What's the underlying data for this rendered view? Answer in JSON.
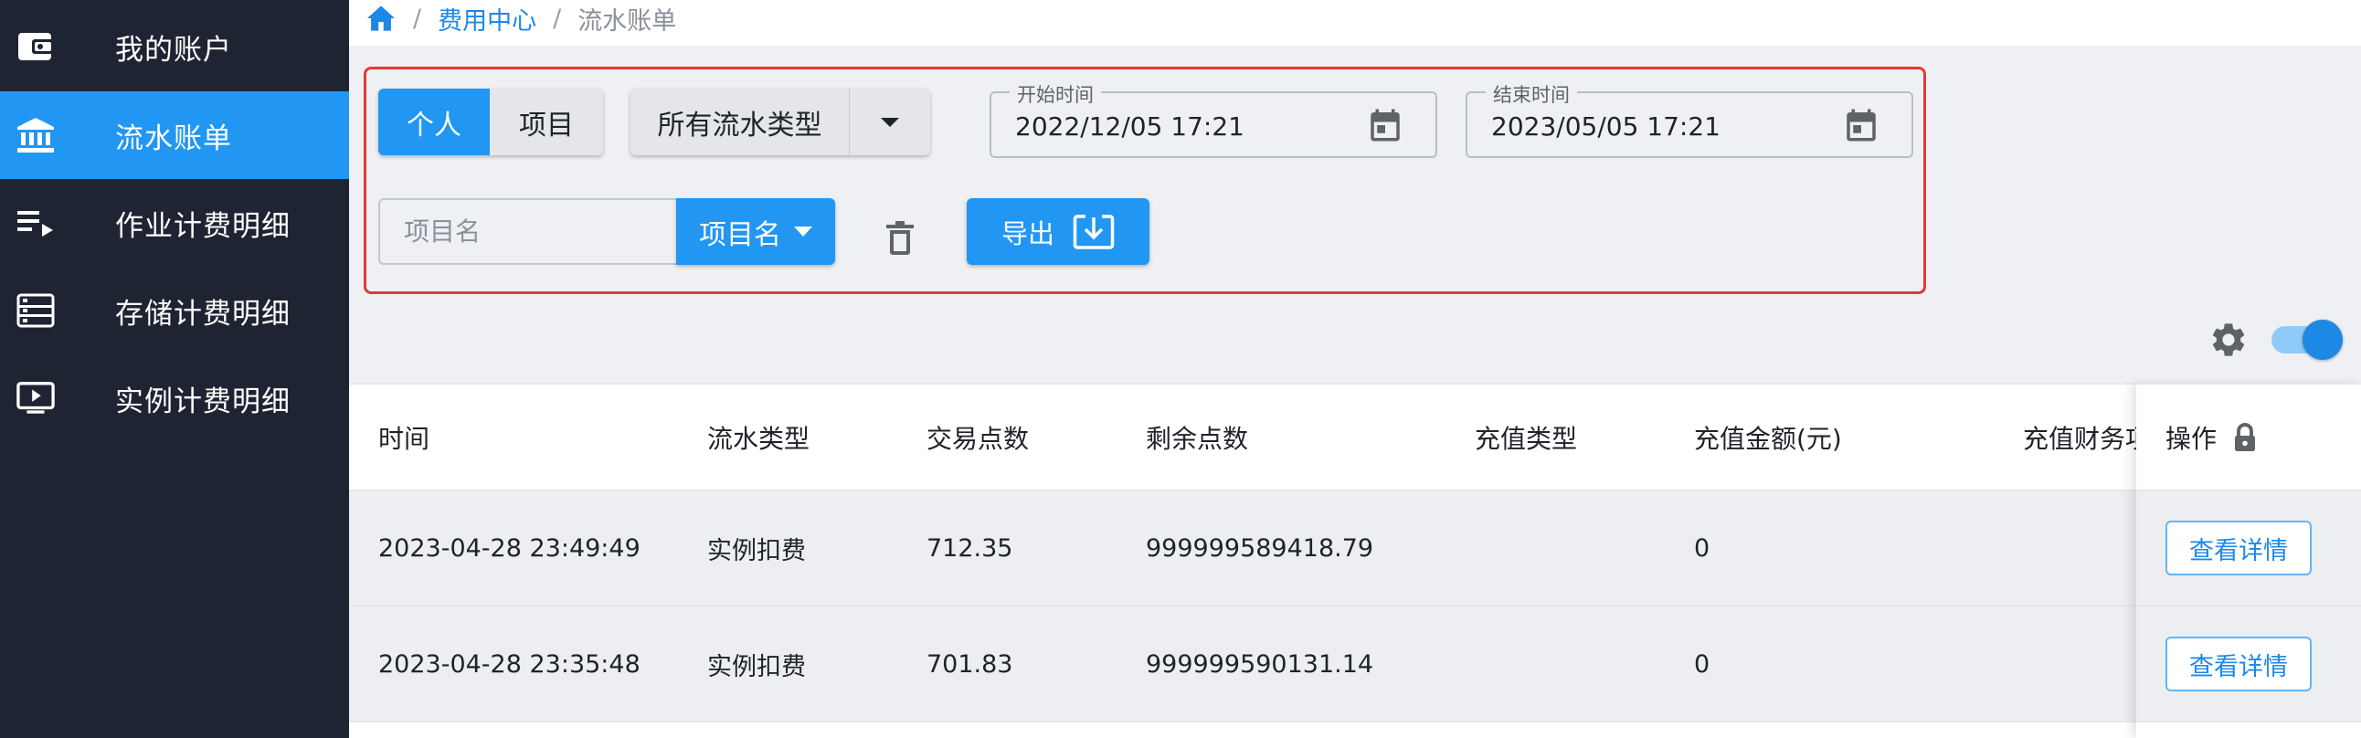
{
  "sidebar": {
    "items": [
      {
        "label": "我的账户",
        "icon": "wallet-icon",
        "active": false
      },
      {
        "label": "流水账单",
        "icon": "bank-icon",
        "active": true
      },
      {
        "label": "作业计费明细",
        "icon": "playlist-icon",
        "active": false
      },
      {
        "label": "存储计费明细",
        "icon": "storage-icon",
        "active": false
      },
      {
        "label": "实例计费明细",
        "icon": "monitor-play-icon",
        "active": false
      }
    ]
  },
  "breadcrumb": {
    "home_icon": "home-icon",
    "separator": "/",
    "parent": "费用中心",
    "current": "流水账单"
  },
  "filters": {
    "scope_options": [
      "个人",
      "项目"
    ],
    "scope_selected": "个人",
    "flow_type": "所有流水类型",
    "start": {
      "label": "开始时间",
      "value": "2022/12/05 17:21"
    },
    "end": {
      "label": "结束时间",
      "value": "2023/05/05 17:21"
    },
    "name_placeholder": "项目名",
    "name_field": "项目名",
    "export_label": "导出"
  },
  "table": {
    "columns": [
      "时间",
      "流水类型",
      "交易点数",
      "剩余点数",
      "充值类型",
      "充值金额(元)",
      "充值财务项"
    ],
    "ops_header": "操作",
    "rows": [
      {
        "time": "2023-04-28 23:49:49",
        "type": "实例扣费",
        "points": "712.35",
        "remaining": "999999589418.79",
        "recharge_type": "",
        "amount": "0",
        "finance": "",
        "action": "查看详情"
      },
      {
        "time": "2023-04-28 23:35:48",
        "type": "实例扣费",
        "points": "701.83",
        "remaining": "999999590131.14",
        "recharge_type": "",
        "amount": "0",
        "finance": "",
        "action": "查看详情"
      }
    ]
  },
  "colors": {
    "accent": "#2196f3",
    "sidebar_bg": "#1f2433",
    "highlight_border": "#e53935"
  }
}
